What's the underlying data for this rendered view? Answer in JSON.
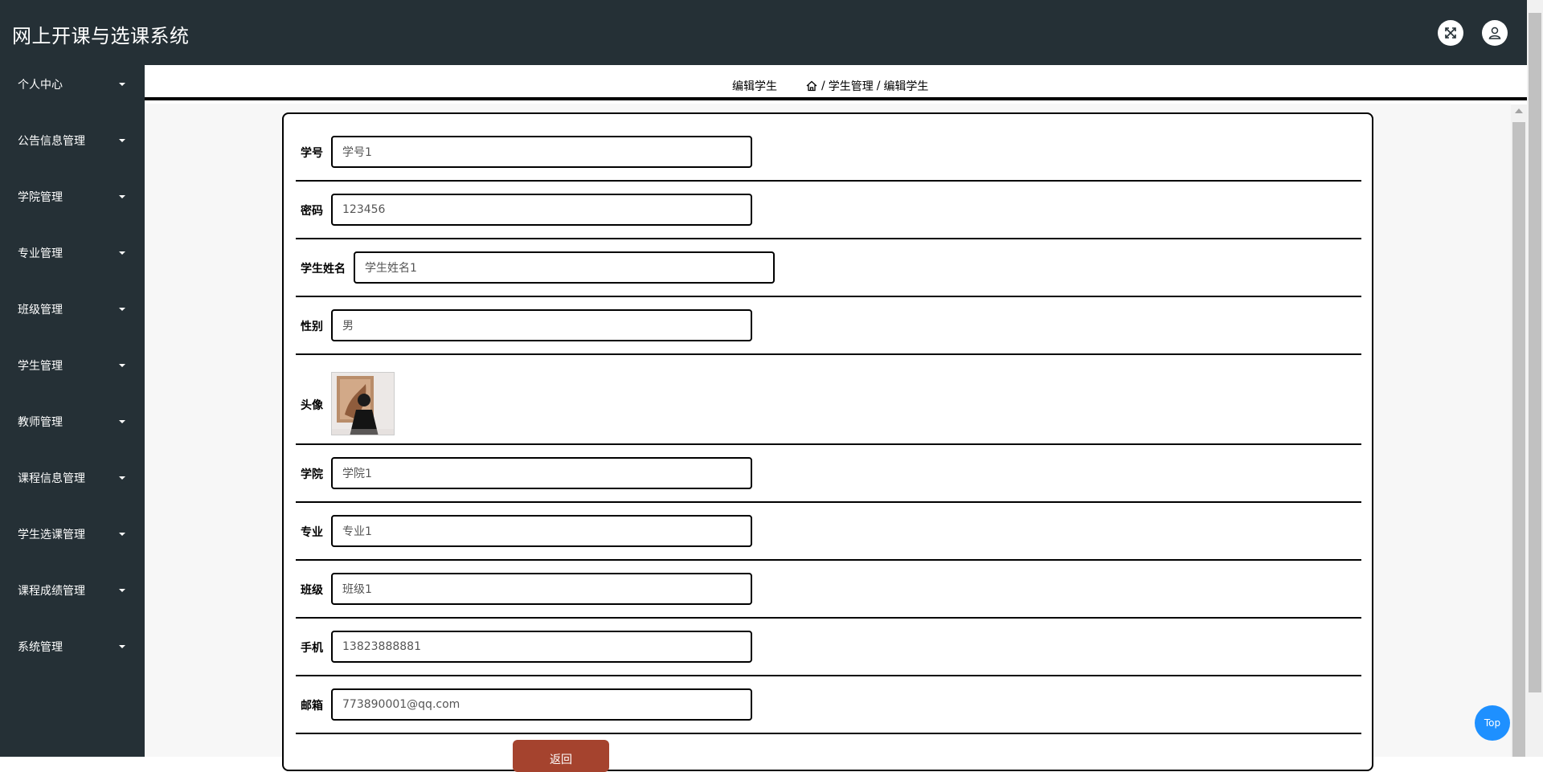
{
  "app": {
    "title": "网上开课与选课系统"
  },
  "header": {
    "fullscreen_icon": "fullscreen-icon",
    "user_icon": "user-icon"
  },
  "sidebar": {
    "items": [
      {
        "label": "个人中心"
      },
      {
        "label": "公告信息管理"
      },
      {
        "label": "学院管理"
      },
      {
        "label": "专业管理"
      },
      {
        "label": "班级管理"
      },
      {
        "label": "学生管理"
      },
      {
        "label": "教师管理"
      },
      {
        "label": "课程信息管理"
      },
      {
        "label": "学生选课管理"
      },
      {
        "label": "课程成绩管理"
      },
      {
        "label": "系统管理"
      }
    ]
  },
  "breadcrumb": {
    "current": "编辑学生",
    "home_icon": "home-icon",
    "separator": "/",
    "path": [
      "学生管理",
      "编辑学生"
    ]
  },
  "form": {
    "fields": [
      {
        "label": "学号",
        "value": "学号1"
      },
      {
        "label": "密码",
        "value": "123456"
      },
      {
        "label": "学生姓名",
        "value": "学生姓名1"
      },
      {
        "label": "性别",
        "value": "男"
      },
      {
        "label": "头像"
      },
      {
        "label": "学院",
        "value": "学院1"
      },
      {
        "label": "专业",
        "value": "专业1"
      },
      {
        "label": "班级",
        "value": "班级1"
      },
      {
        "label": "手机",
        "value": "13823888881"
      },
      {
        "label": "邮箱",
        "value": "773890001@qq.com"
      }
    ],
    "back_label": "返回"
  },
  "top_button": {
    "label": "Top"
  },
  "colors": {
    "header_bg": "#253036",
    "sidebar_bg": "#253036",
    "back_button": "#a5432e",
    "top_button": "#1e90ff"
  }
}
